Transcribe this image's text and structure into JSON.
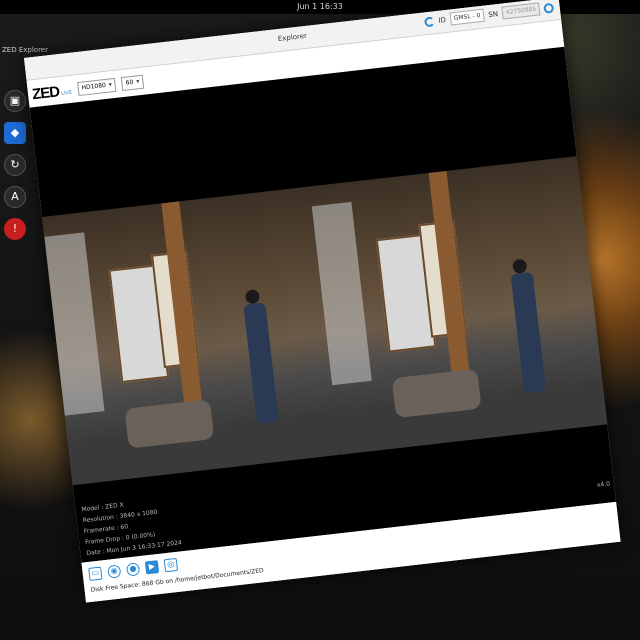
{
  "system": {
    "clock": "Jun 1 16:33",
    "app_menu": "ZED Explorer"
  },
  "window": {
    "title": "Explorer",
    "id_label": "ID",
    "camera_select": "GMSL - 0",
    "sn_label": "SN",
    "sn_value": "42750885"
  },
  "header": {
    "logo": "ZED",
    "logo_sub": "LIVE",
    "resolution": "HD1080",
    "fps": "60"
  },
  "info": {
    "model": "Model : ZED X",
    "resolution": "Resolution : 3840 x 1080",
    "framerate": "Framerate : 60",
    "frame_drop": "Frame Drop : 0 (0.00%)",
    "date": "Date : Mon Jun 3 16:33:17 2024"
  },
  "scale": "x4.0",
  "status": "Disk Free Space: 868 Gb on /home/jetbot/Documents/ZED",
  "toolbar_icons": [
    "folder-icon",
    "broadcast-icon",
    "record-icon",
    "video-icon",
    "camera-icon"
  ]
}
